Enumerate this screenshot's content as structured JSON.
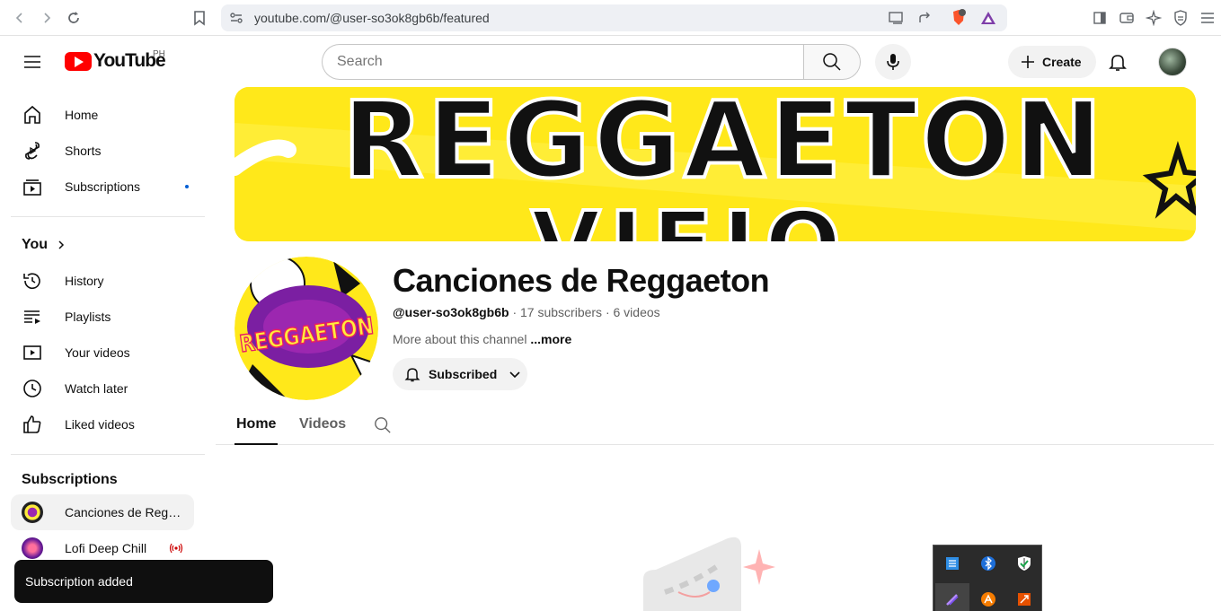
{
  "browser": {
    "url": "youtube.com/@user-so3ok8gb6b/featured",
    "brave_badge": "7"
  },
  "header": {
    "logo_text": "YouTube",
    "country_code": "PH",
    "search_placeholder": "Search",
    "create_label": "Create"
  },
  "sidebar": {
    "main": [
      {
        "label": "Home",
        "icon": "home-icon"
      },
      {
        "label": "Shorts",
        "icon": "shorts-icon"
      },
      {
        "label": "Subscriptions",
        "icon": "subscriptions-icon"
      }
    ],
    "you_title": "You",
    "you_items": [
      {
        "label": "History",
        "icon": "history-icon"
      },
      {
        "label": "Playlists",
        "icon": "playlists-icon"
      },
      {
        "label": "Your videos",
        "icon": "your-videos-icon"
      },
      {
        "label": "Watch later",
        "icon": "watch-later-icon"
      },
      {
        "label": "Liked videos",
        "icon": "liked-videos-icon"
      }
    ],
    "subs_title": "Subscriptions",
    "subs": [
      {
        "label": "Canciones de Reggaeton",
        "active": true
      },
      {
        "label": "Lofi Deep Chill",
        "live": true
      }
    ]
  },
  "toast": {
    "message": "Subscription added"
  },
  "channel": {
    "name": "Canciones de Reggaeton",
    "handle": "@user-so3ok8gb6b",
    "stats": " · 17 subscribers · 6 videos",
    "more_about": "More about this channel ",
    "more_link": "...more",
    "subscribed_label": "Subscribed",
    "avatar_text": "REGGAETON",
    "banner_text_1": "REGGAETON",
    "banner_text_2": "VIEJO"
  },
  "tabs": [
    {
      "label": "Home",
      "active": true
    },
    {
      "label": "Videos",
      "active": false
    }
  ],
  "colors": {
    "brand_red": "#ff0000",
    "banner_yellow": "#ffe81a",
    "avatar_purple": "#7b1fa2",
    "subscription_dot": "#065fd4"
  }
}
